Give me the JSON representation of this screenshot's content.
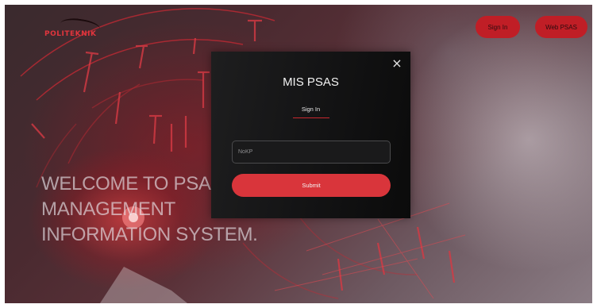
{
  "header": {
    "logo_text": "POLITEKNIK",
    "nav": {
      "sign_in_label": "Sign In",
      "web_psas_label": "Web PSAS"
    }
  },
  "hero": {
    "lines": [
      "WELCOME TO PSAS",
      "MANAGEMENT",
      "INFORMATION SYSTEM."
    ]
  },
  "modal": {
    "title": "MIS PSAS",
    "tab_label": "Sign In",
    "field_placeholder": "NoKP",
    "submit_label": "Submit",
    "close_symbol": "×"
  },
  "colors": {
    "accent_red": "#d9353b",
    "modal_bg": "#141415",
    "nav_button": "#c01e26"
  },
  "icons": {
    "close": "close-icon"
  }
}
